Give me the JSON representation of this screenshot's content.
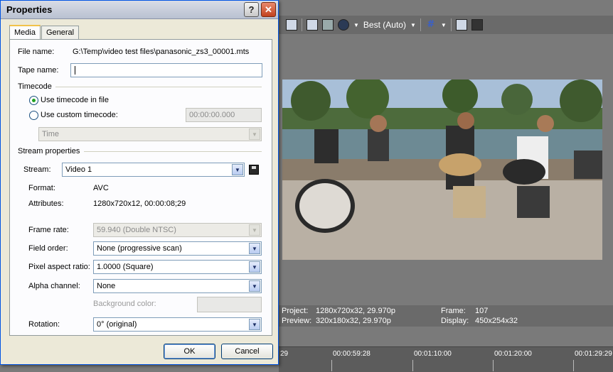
{
  "dialog": {
    "title": "Properties",
    "help_glyph": "?",
    "close_glyph": "✕",
    "tabs": [
      "Media",
      "General"
    ],
    "file_name_label": "File name:",
    "file_name_value": "G:\\Temp\\video test files\\panasonic_zs3_00001.mts",
    "tape_name_label": "Tape name:",
    "tape_name_value": "",
    "timecode_group": "Timecode",
    "use_timecode_in_file": "Use timecode in file",
    "use_custom_timecode": "Use custom timecode:",
    "custom_timecode_value": "00:00:00.000",
    "timecode_format": "Time",
    "stream_group": "Stream properties",
    "stream_label": "Stream:",
    "stream_value": "Video 1",
    "format_label": "Format:",
    "format_value": "AVC",
    "attributes_label": "Attributes:",
    "attributes_value": "1280x720x12, 00:00:08;29",
    "frame_rate_label": "Frame rate:",
    "frame_rate_value": "59.940 (Double NTSC)",
    "field_order_label": "Field order:",
    "field_order_value": "None (progressive scan)",
    "pixel_aspect_label": "Pixel aspect ratio:",
    "pixel_aspect_value": "1.0000 (Square)",
    "alpha_label": "Alpha channel:",
    "alpha_value": "None",
    "background_color_label": "Background color:",
    "rotation_label": "Rotation:",
    "rotation_value": "0° (original)",
    "ok_label": "OK",
    "cancel_label": "Cancel"
  },
  "preview": {
    "quality": "Best (Auto)",
    "project_label": "Project:",
    "project_value": "1280x720x32, 29.970p",
    "preview_label": "Preview:",
    "preview_value": "320x180x32, 29.970p",
    "frame_label": "Frame:",
    "frame_value": "107",
    "display_label": "Display:",
    "display_value": "450x254x32"
  },
  "timeline": {
    "ticks": [
      "29",
      "00:00:59:28",
      "00:01:10:00",
      "00:01:20:00",
      "00:01:29:29"
    ]
  },
  "colors": {
    "title_gradient": "#b9c1d1",
    "close_button": "#c2411d",
    "radio_dot": "#21a121"
  }
}
